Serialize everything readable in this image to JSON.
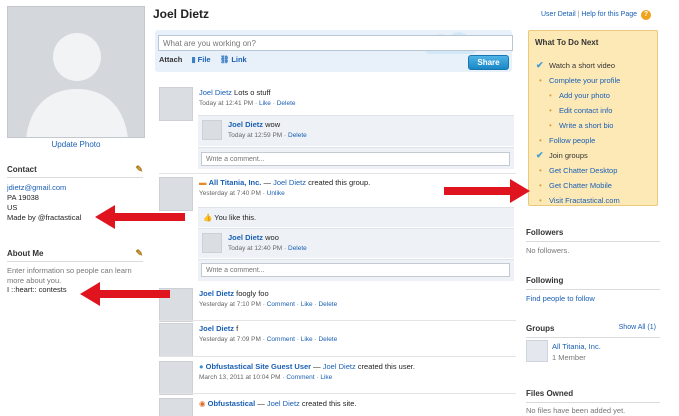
{
  "profile": {
    "name": "Joel Dietz",
    "update_photo": "Update Photo"
  },
  "contact": {
    "title": "Contact",
    "email": "jdietz@gmail.com",
    "zip": "PA 19038",
    "country": "US",
    "made_by": "Made by @fractastical"
  },
  "about": {
    "title": "About Me",
    "placeholder_line1": "Enter information so people can learn",
    "placeholder_line2": "more about you.",
    "text": "I ::heart:: contests"
  },
  "composer": {
    "placeholder": "What are you working on?",
    "attach_label": "Attach",
    "file_label": "File",
    "link_label": "Link",
    "share_label": "Share"
  },
  "header_links": {
    "user_detail": "User Detail",
    "separator": "|",
    "help": "Help for this Page"
  },
  "feed": {
    "post1": {
      "author": "Joel Dietz",
      "text": "Lots o stuff",
      "time": "Today at 12:41 PM",
      "like": "Like",
      "delete": "Delete"
    },
    "comment1": {
      "author": "Joel Dietz",
      "text": "wow",
      "time": "Today at 12:59 PM",
      "delete": "Delete"
    },
    "comment_placeholder": "Write a comment...",
    "post2": {
      "group": "All Titania, Inc.",
      "dash": "—",
      "author": "Joel Dietz",
      "text": "created this group.",
      "time": "Yesterday at 7:40 PM",
      "unlike": "Unlike"
    },
    "you_like": "You like this.",
    "comment2": {
      "author": "Joel Dietz",
      "text": "woo",
      "time": "Today at 12:40 PM",
      "delete": "Delete"
    },
    "post3": {
      "author": "Joel Dietz",
      "text": "foogly foo",
      "time": "Yesterday at 7:10 PM",
      "comment": "Comment",
      "like": "Like",
      "delete": "Delete"
    },
    "post4": {
      "author": "Joel Dietz",
      "text": "f",
      "time": "Yesterday at 7:09 PM",
      "comment": "Comment",
      "like": "Like",
      "delete": "Delete"
    },
    "post5": {
      "actor": "Obfustastical Site Guest User",
      "dash": "—",
      "author": "Joel Dietz",
      "text": "created this user.",
      "time": "March 13, 2011 at 10:04 PM",
      "comment": "Comment",
      "like": "Like"
    },
    "post6": {
      "actor": "Obfustastical",
      "dash": "—",
      "author": "Joel Dietz",
      "text": "created this site."
    },
    "sep": "·"
  },
  "todo": {
    "title": "What To Do Next",
    "items": [
      "Watch a short video",
      "Complete your profile",
      "Add your photo",
      "Edit contact info",
      "Write a short bio",
      "Follow people",
      "Join groups",
      "Get Chatter Desktop",
      "Get Chatter Mobile",
      "Visit Fractastical.com"
    ]
  },
  "followers": {
    "title": "Followers",
    "text": "No followers."
  },
  "following": {
    "title": "Following",
    "text": "Find people to follow"
  },
  "groups": {
    "title": "Groups",
    "show_all": "Show All (1)",
    "name": "All Titania, Inc.",
    "members": "1 Member"
  },
  "files": {
    "title": "Files Owned",
    "text": "No files have been added yet."
  },
  "colors": {
    "link": "#1a5fb4",
    "todo_bg": "#fde9b6",
    "arrow": "#e0141e",
    "share": "#1987c5"
  },
  "icons": [
    "pencil-icon",
    "help-icon",
    "file-icon",
    "link-icon",
    "cloud-icon",
    "thumbs-up-icon",
    "check-icon",
    "arrow-icon"
  ]
}
